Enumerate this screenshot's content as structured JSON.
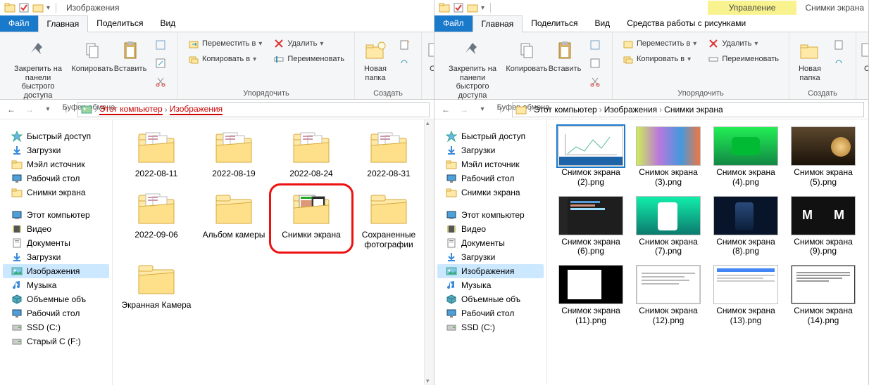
{
  "left": {
    "title": "Изображения",
    "tabs": {
      "file": "Файл",
      "home": "Главная",
      "share": "Поделиться",
      "view": "Вид"
    },
    "ribbon": {
      "pin": "Закрепить на панели быстрого доступа",
      "copy": "Копировать",
      "paste": "Вставить",
      "grp_clip": "Буфер обмена",
      "move": "Переместить в",
      "copyto": "Копировать в",
      "delete": "Удалить",
      "rename": "Переименовать",
      "grp_org": "Упорядочить",
      "newfolder": "Новая папка",
      "grp_new": "Создать",
      "prop_prefix": "Св"
    },
    "bc": {
      "pc": "Этот компьютер",
      "pics": "Изображения"
    },
    "tree": {
      "quick": "Быстрый доступ",
      "downloads": "Загрузки",
      "mail": "Мэйл источник",
      "desktop": "Рабочий стол",
      "screens": "Снимки экрана",
      "thispc": "Этот компьютер",
      "videos": "Видео",
      "documents": "Документы",
      "downloads2": "Загрузки",
      "images": "Изображения",
      "music": "Музыка",
      "volumes": "Объемные объ",
      "desktop2": "Рабочий стол",
      "ssd": "SSD (C:)",
      "old": "Старый С (F:)"
    },
    "items": [
      {
        "label": "2022-08-11",
        "type": "folder-doc"
      },
      {
        "label": "2022-08-19",
        "type": "folder-doc"
      },
      {
        "label": "2022-08-24",
        "type": "folder-doc"
      },
      {
        "label": "2022-08-31",
        "type": "folder-doc"
      },
      {
        "label": "2022-09-06",
        "type": "folder-doc"
      },
      {
        "label": "Альбом камеры",
        "type": "folder"
      },
      {
        "label": "Снимки экрана",
        "type": "folder-shots",
        "circled": true
      },
      {
        "label": "Сохраненные фотографии",
        "type": "folder"
      },
      {
        "label": "Экранная Камера",
        "type": "folder"
      }
    ]
  },
  "right": {
    "title": "Снимки экрана",
    "context_tab": "Управление",
    "context_group": "Средства работы с рисунками",
    "tabs": {
      "file": "Файл",
      "home": "Главная",
      "share": "Поделиться",
      "view": "Вид"
    },
    "ribbon": {
      "pin": "Закрепить на панели быстрого доступа",
      "copy": "Копировать",
      "paste": "Вставить",
      "grp_clip": "Буфер обмена",
      "move": "Переместить в",
      "copyto": "Копировать в",
      "delete": "Удалить",
      "rename": "Переименовать",
      "grp_org": "Упорядочить",
      "newfolder": "Новая папка",
      "grp_new": "Создать",
      "prop_prefix": "С"
    },
    "bc": {
      "pc": "Этот компьютер",
      "pics": "Изображения",
      "screens": "Снимки экрана"
    },
    "tree": {
      "quick": "Быстрый доступ",
      "downloads": "Загрузки",
      "mail": "Мэйл источник",
      "desktop": "Рабочий стол",
      "screens": "Снимки экрана",
      "thispc": "Этот компьютер",
      "videos": "Видео",
      "documents": "Документы",
      "downloads2": "Загрузки",
      "images": "Изображения",
      "music": "Музыка",
      "volumes": "Объемные объ",
      "desktop2": "Рабочий стол",
      "ssd": "SSD (C:)"
    },
    "items": [
      {
        "label": "Снимок экрана (2).png",
        "thumb": "chart",
        "selected": true
      },
      {
        "label": "Снимок экрана (3).png",
        "thumb": "phones"
      },
      {
        "label": "Снимок экрана (4).png",
        "thumb": "green"
      },
      {
        "label": "Снимок экрана (5).png",
        "thumb": "dark"
      },
      {
        "label": "Снимок экрана (6).png",
        "thumb": "vscode"
      },
      {
        "label": "Снимок экрана (7).png",
        "thumb": "teal"
      },
      {
        "label": "Снимок экрана (8).png",
        "thumb": "night"
      },
      {
        "label": "Снимок экрана (9).png",
        "thumb": "logo"
      },
      {
        "label": "Снимок экрана (11).png",
        "thumb": "editor"
      },
      {
        "label": "Снимок экрана (12).png",
        "thumb": "doc"
      },
      {
        "label": "Снимок экрана (13).png",
        "thumb": "list"
      },
      {
        "label": "Снимок экрана (14).png",
        "thumb": "text"
      }
    ]
  }
}
